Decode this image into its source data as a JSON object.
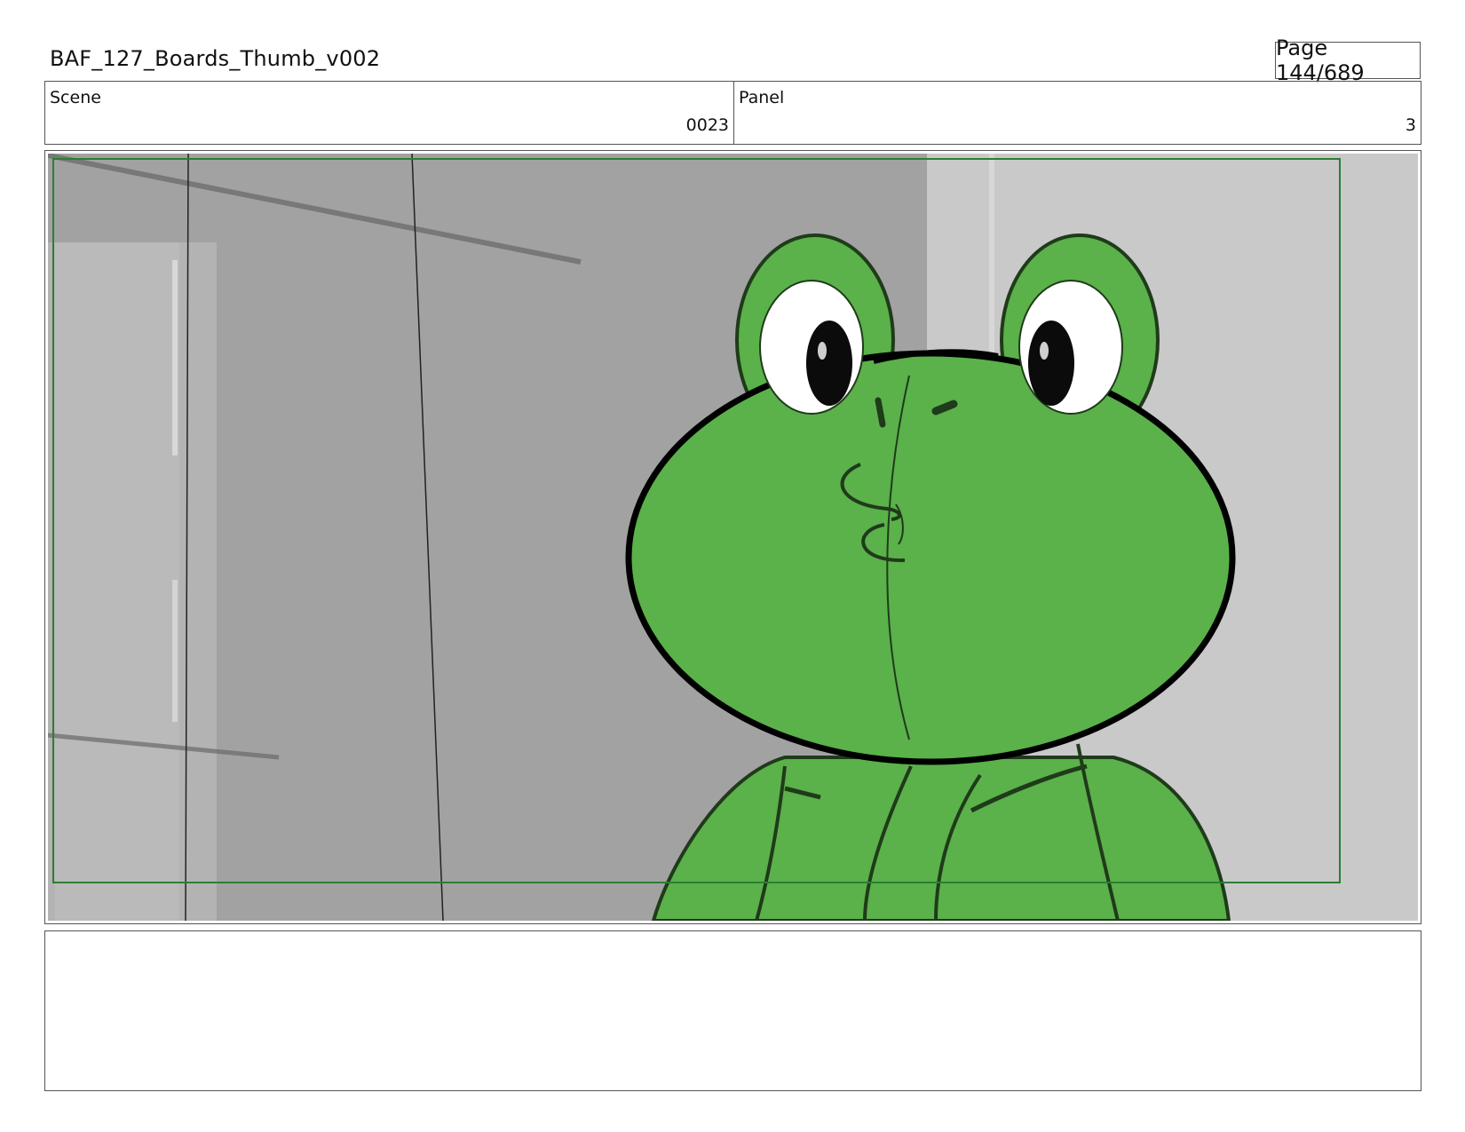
{
  "header": {
    "document_title": "BAF_127_Boards_Thumb_v002",
    "page_indicator": "Page 144/689"
  },
  "scene": {
    "label": "Scene",
    "value": "0023"
  },
  "panel": {
    "label": "Panel",
    "value": "3"
  },
  "artwork": {
    "subject": "green frog character",
    "colors": {
      "frog": "#5bb14a",
      "frame_border": "#2e7d32",
      "wall_dark": "#a2a2a2",
      "wall_light": "#c9c9c9"
    }
  },
  "notes": {
    "text": ""
  }
}
